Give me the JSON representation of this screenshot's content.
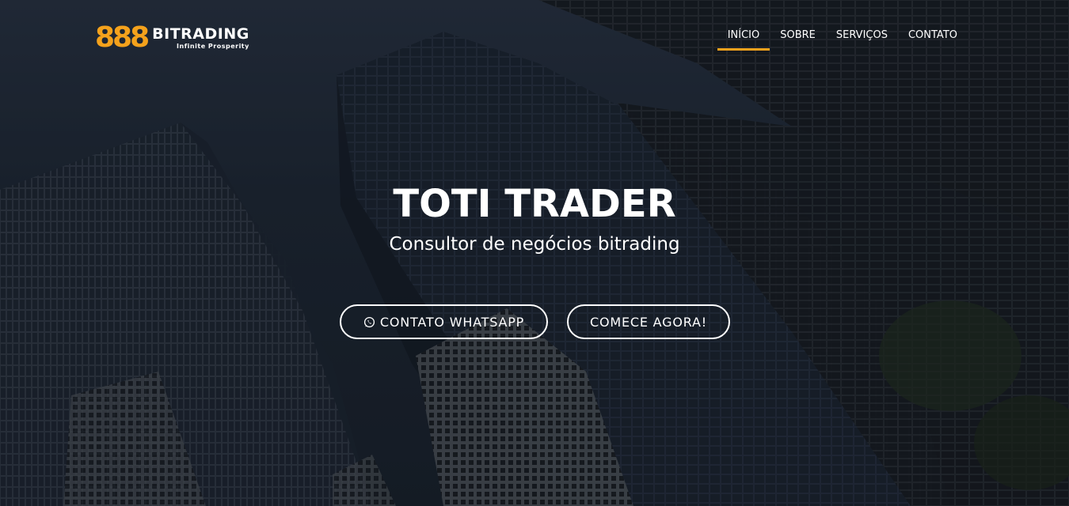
{
  "brand": {
    "mark": "888",
    "word": "BITRADING",
    "tagline": "Infinite Prosperity",
    "accent_color": "#f5a21c"
  },
  "nav": {
    "items": [
      {
        "label": "INÍCIO",
        "active": true
      },
      {
        "label": "SOBRE",
        "active": false
      },
      {
        "label": "SERVIÇOS",
        "active": false
      },
      {
        "label": "CONTATO",
        "active": false
      }
    ]
  },
  "hero": {
    "title": "TOTI TRADER",
    "subtitle": "Consultor de negócios bitrading",
    "buttons": {
      "whatsapp_label": "CONTATO WHATSAPP",
      "whatsapp_icon": "whatsapp-icon",
      "start_label": "COMECE AGORA!"
    },
    "background": "skyscrapers-photo"
  }
}
